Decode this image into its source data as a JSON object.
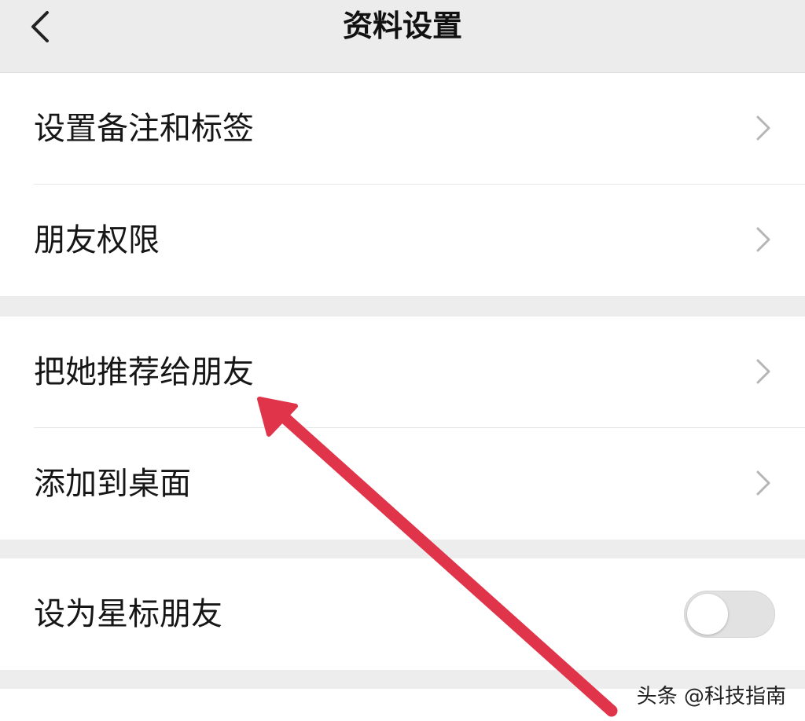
{
  "header": {
    "title": "资料设置",
    "back_icon": "chevron-left-icon"
  },
  "groups": [
    {
      "items": [
        {
          "label": "设置备注和标签",
          "accessory": "chevron-right-icon"
        },
        {
          "label": "朋友权限",
          "accessory": "chevron-right-icon"
        }
      ]
    },
    {
      "items": [
        {
          "label": "把她推荐给朋友",
          "accessory": "chevron-right-icon"
        },
        {
          "label": "添加到桌面",
          "accessory": "chevron-right-icon"
        }
      ]
    },
    {
      "items": [
        {
          "label": "设为星标朋友",
          "accessory": "toggle",
          "toggle_on": false
        }
      ]
    }
  ],
  "annotation": {
    "arrow_color": "#e0344a",
    "points_to": "把她推荐给朋友"
  },
  "watermark": {
    "text": "头条 @科技指南"
  },
  "colors": {
    "background": "#ededed",
    "card": "#ffffff",
    "text": "#161616",
    "chevron": "#b5b5b5"
  }
}
